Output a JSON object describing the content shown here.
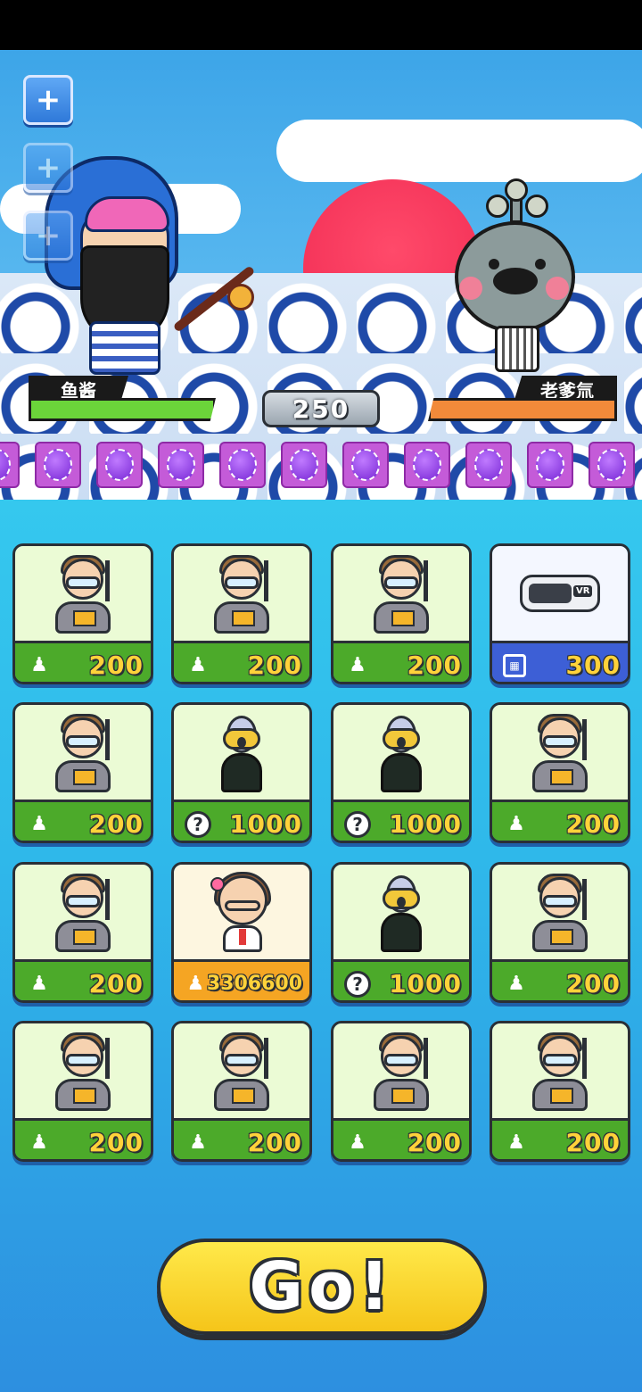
{
  "scene": {
    "player_name": "鱼酱",
    "enemy_name": "老爹氚",
    "score": "250",
    "player_hp_color": "#6bd43a",
    "enemy_hp_color": "#f28a3a"
  },
  "side_buttons": [
    {
      "icon": "plus-icon",
      "glyph": "+"
    },
    {
      "icon": "plus-icon",
      "glyph": "+"
    },
    {
      "icon": "plus-icon",
      "glyph": "+"
    }
  ],
  "gems": {
    "count": 11,
    "icon": "purple-orb-icon",
    "color": "#c45bd8"
  },
  "cards": [
    {
      "avatar": "teacher",
      "type": "person",
      "price": "200"
    },
    {
      "avatar": "teacher",
      "type": "person",
      "price": "200"
    },
    {
      "avatar": "teacher",
      "type": "person",
      "price": "200"
    },
    {
      "avatar": "vr",
      "type": "chip",
      "price": "300"
    },
    {
      "avatar": "teacher",
      "type": "person",
      "price": "200"
    },
    {
      "avatar": "scream",
      "type": "question",
      "price": "1000"
    },
    {
      "avatar": "scream",
      "type": "question",
      "price": "1000"
    },
    {
      "avatar": "teacher",
      "type": "person",
      "price": "200"
    },
    {
      "avatar": "teacher",
      "type": "person",
      "price": "200"
    },
    {
      "avatar": "girl",
      "type": "person",
      "price": "3306600"
    },
    {
      "avatar": "scream",
      "type": "question",
      "price": "1000"
    },
    {
      "avatar": "teacher",
      "type": "person",
      "price": "200"
    },
    {
      "avatar": "teacher",
      "type": "person",
      "price": "200"
    },
    {
      "avatar": "teacher",
      "type": "person",
      "price": "200"
    },
    {
      "avatar": "teacher",
      "type": "person",
      "price": "200"
    },
    {
      "avatar": "teacher",
      "type": "person",
      "price": "200"
    }
  ],
  "go_button": {
    "label": "Go!"
  }
}
